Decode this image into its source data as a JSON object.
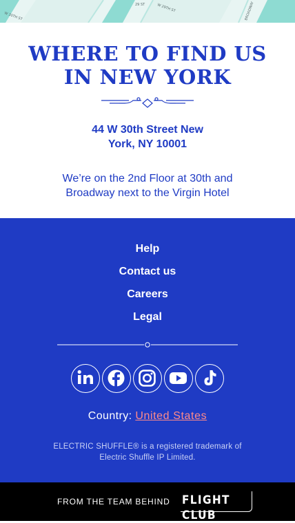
{
  "map": {
    "street_labels": [
      "W 30TH ST",
      "29 ST",
      "W 29TH ST",
      "BROADWAY"
    ]
  },
  "location": {
    "title_line1": "WHERE TO FIND US",
    "title_line2": "IN NEW YORK",
    "address_line1": "44 W 30th Street New",
    "address_line2": "York, NY 10001",
    "directions": "We’re on the 2nd Floor at 30th and Broadway next to the Virgin Hotel"
  },
  "footer": {
    "links": [
      "Help",
      "Contact us",
      "Careers",
      "Legal"
    ],
    "social": [
      {
        "icon": "linkedin-icon"
      },
      {
        "icon": "facebook-icon"
      },
      {
        "icon": "instagram-icon"
      },
      {
        "icon": "youtube-icon"
      },
      {
        "icon": "tiktok-icon"
      }
    ],
    "country_label": "Country:",
    "country_value": "United States",
    "trademark": "ELECTRIC SHUFFLE® is a registered trademark of Electric Shuffle IP Limited."
  },
  "team_bar": {
    "label": "FROM THE TEAM BEHIND",
    "logo_text": "FLIGHT CLUB"
  },
  "colors": {
    "brand_blue": "#1f3bc4",
    "link_pink": "#ff8a8a",
    "map_teal": "#7fd6cc",
    "black": "#000000"
  }
}
